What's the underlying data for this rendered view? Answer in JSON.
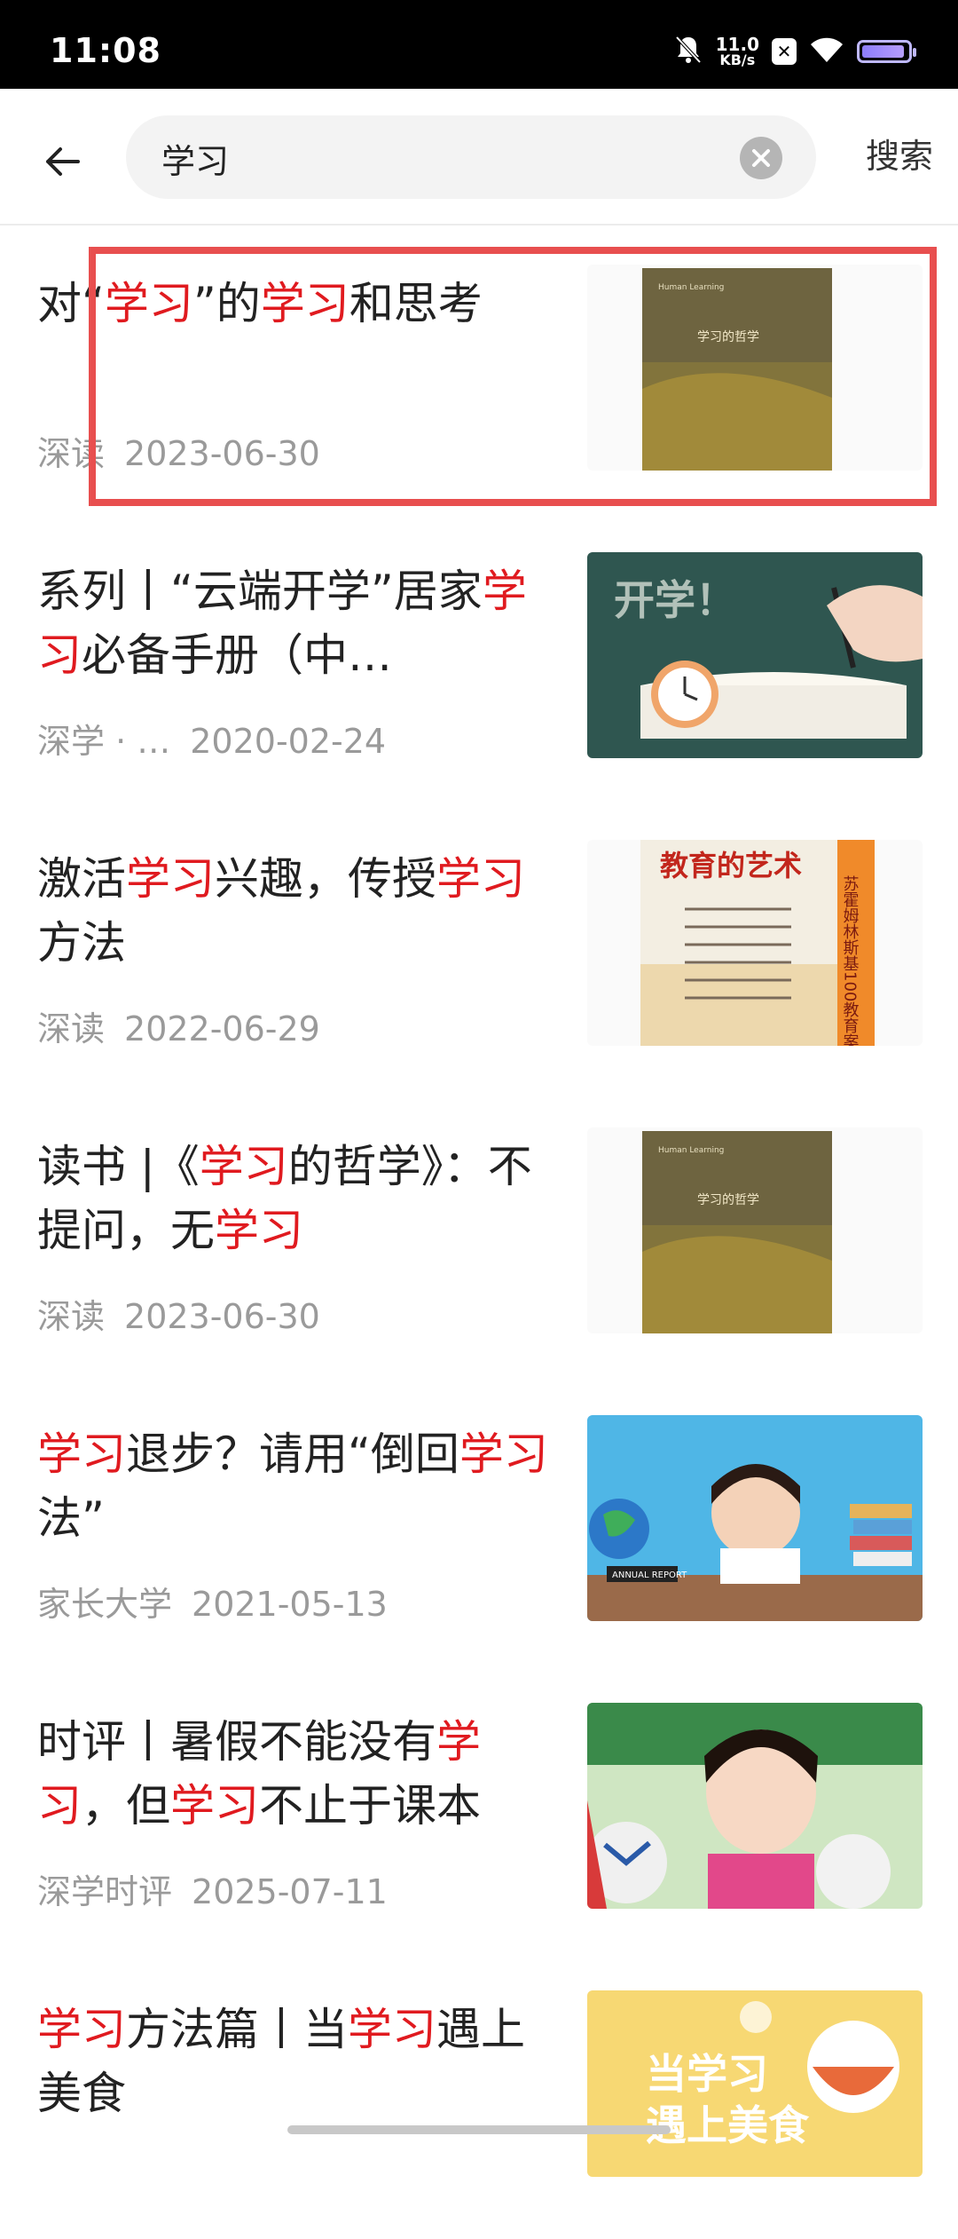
{
  "status_bar": {
    "time": "11:08",
    "net_speed_value": "11.0",
    "net_speed_unit": "KB/s",
    "icons": [
      "mute-bell-icon",
      "close-box-icon",
      "wifi-icon",
      "battery-icon"
    ]
  },
  "search": {
    "query": "学习",
    "button": "搜索"
  },
  "results": [
    {
      "title_parts": [
        {
          "t": "对“"
        },
        {
          "t": "学习",
          "h": true
        },
        {
          "t": "”的"
        },
        {
          "t": "学习",
          "h": true
        },
        {
          "t": "和思考"
        }
      ],
      "source": "深读",
      "date": "2023-06-30",
      "thumb": "book-cover-philosophy"
    },
    {
      "title_parts": [
        {
          "t": "系列丨“云端开学”居家"
        },
        {
          "t": "学习",
          "h": true
        },
        {
          "t": "必备手册（中…"
        }
      ],
      "source": "深学 · …",
      "date": "2020-02-24",
      "thumb": "classroom-study"
    },
    {
      "title_parts": [
        {
          "t": "激活"
        },
        {
          "t": "学习",
          "h": true
        },
        {
          "t": "兴趣，传授"
        },
        {
          "t": "学习",
          "h": true
        },
        {
          "t": "方法"
        }
      ],
      "source": "深读",
      "date": "2022-06-29",
      "thumb": "book-cover-education-art"
    },
    {
      "title_parts": [
        {
          "t": "读书 |《"
        },
        {
          "t": "学习",
          "h": true
        },
        {
          "t": "的哲学》：不提问，无"
        },
        {
          "t": "学习",
          "h": true
        }
      ],
      "source": "深读",
      "date": "2023-06-30",
      "thumb": "book-cover-philosophy"
    },
    {
      "title_parts": [
        {
          "t": "学习",
          "h": true
        },
        {
          "t": "退步？请用“倒回"
        },
        {
          "t": "学习",
          "h": true
        },
        {
          "t": "法”"
        }
      ],
      "source": "家长大学",
      "date": "2021-05-13",
      "thumb": "child-studying"
    },
    {
      "title_parts": [
        {
          "t": "时评丨暑假不能没有"
        },
        {
          "t": "学习",
          "h": true
        },
        {
          "t": "，但"
        },
        {
          "t": "学习",
          "h": true
        },
        {
          "t": "不止于课本"
        }
      ],
      "source": "深学时评",
      "date": "2025-07-11",
      "thumb": "kids-football"
    },
    {
      "title_parts": [
        {
          "t": "学习",
          "h": true
        },
        {
          "t": "方法篇丨当"
        },
        {
          "t": "学习",
          "h": true
        },
        {
          "t": "遇上美食"
        }
      ],
      "source": "",
      "date": "",
      "thumb": "food-banner"
    }
  ],
  "thumb_texts": {
    "book_subtitle": "Human Learning",
    "book_title": "学习的哲学",
    "kaixue": "开学！",
    "edu_title": "教育的艺术",
    "edu_side": "苏霍姆林斯基100教育案例",
    "food_line1": "当学习",
    "food_line2": "遇上美食",
    "child_book": "ANNUAL REPORT"
  }
}
